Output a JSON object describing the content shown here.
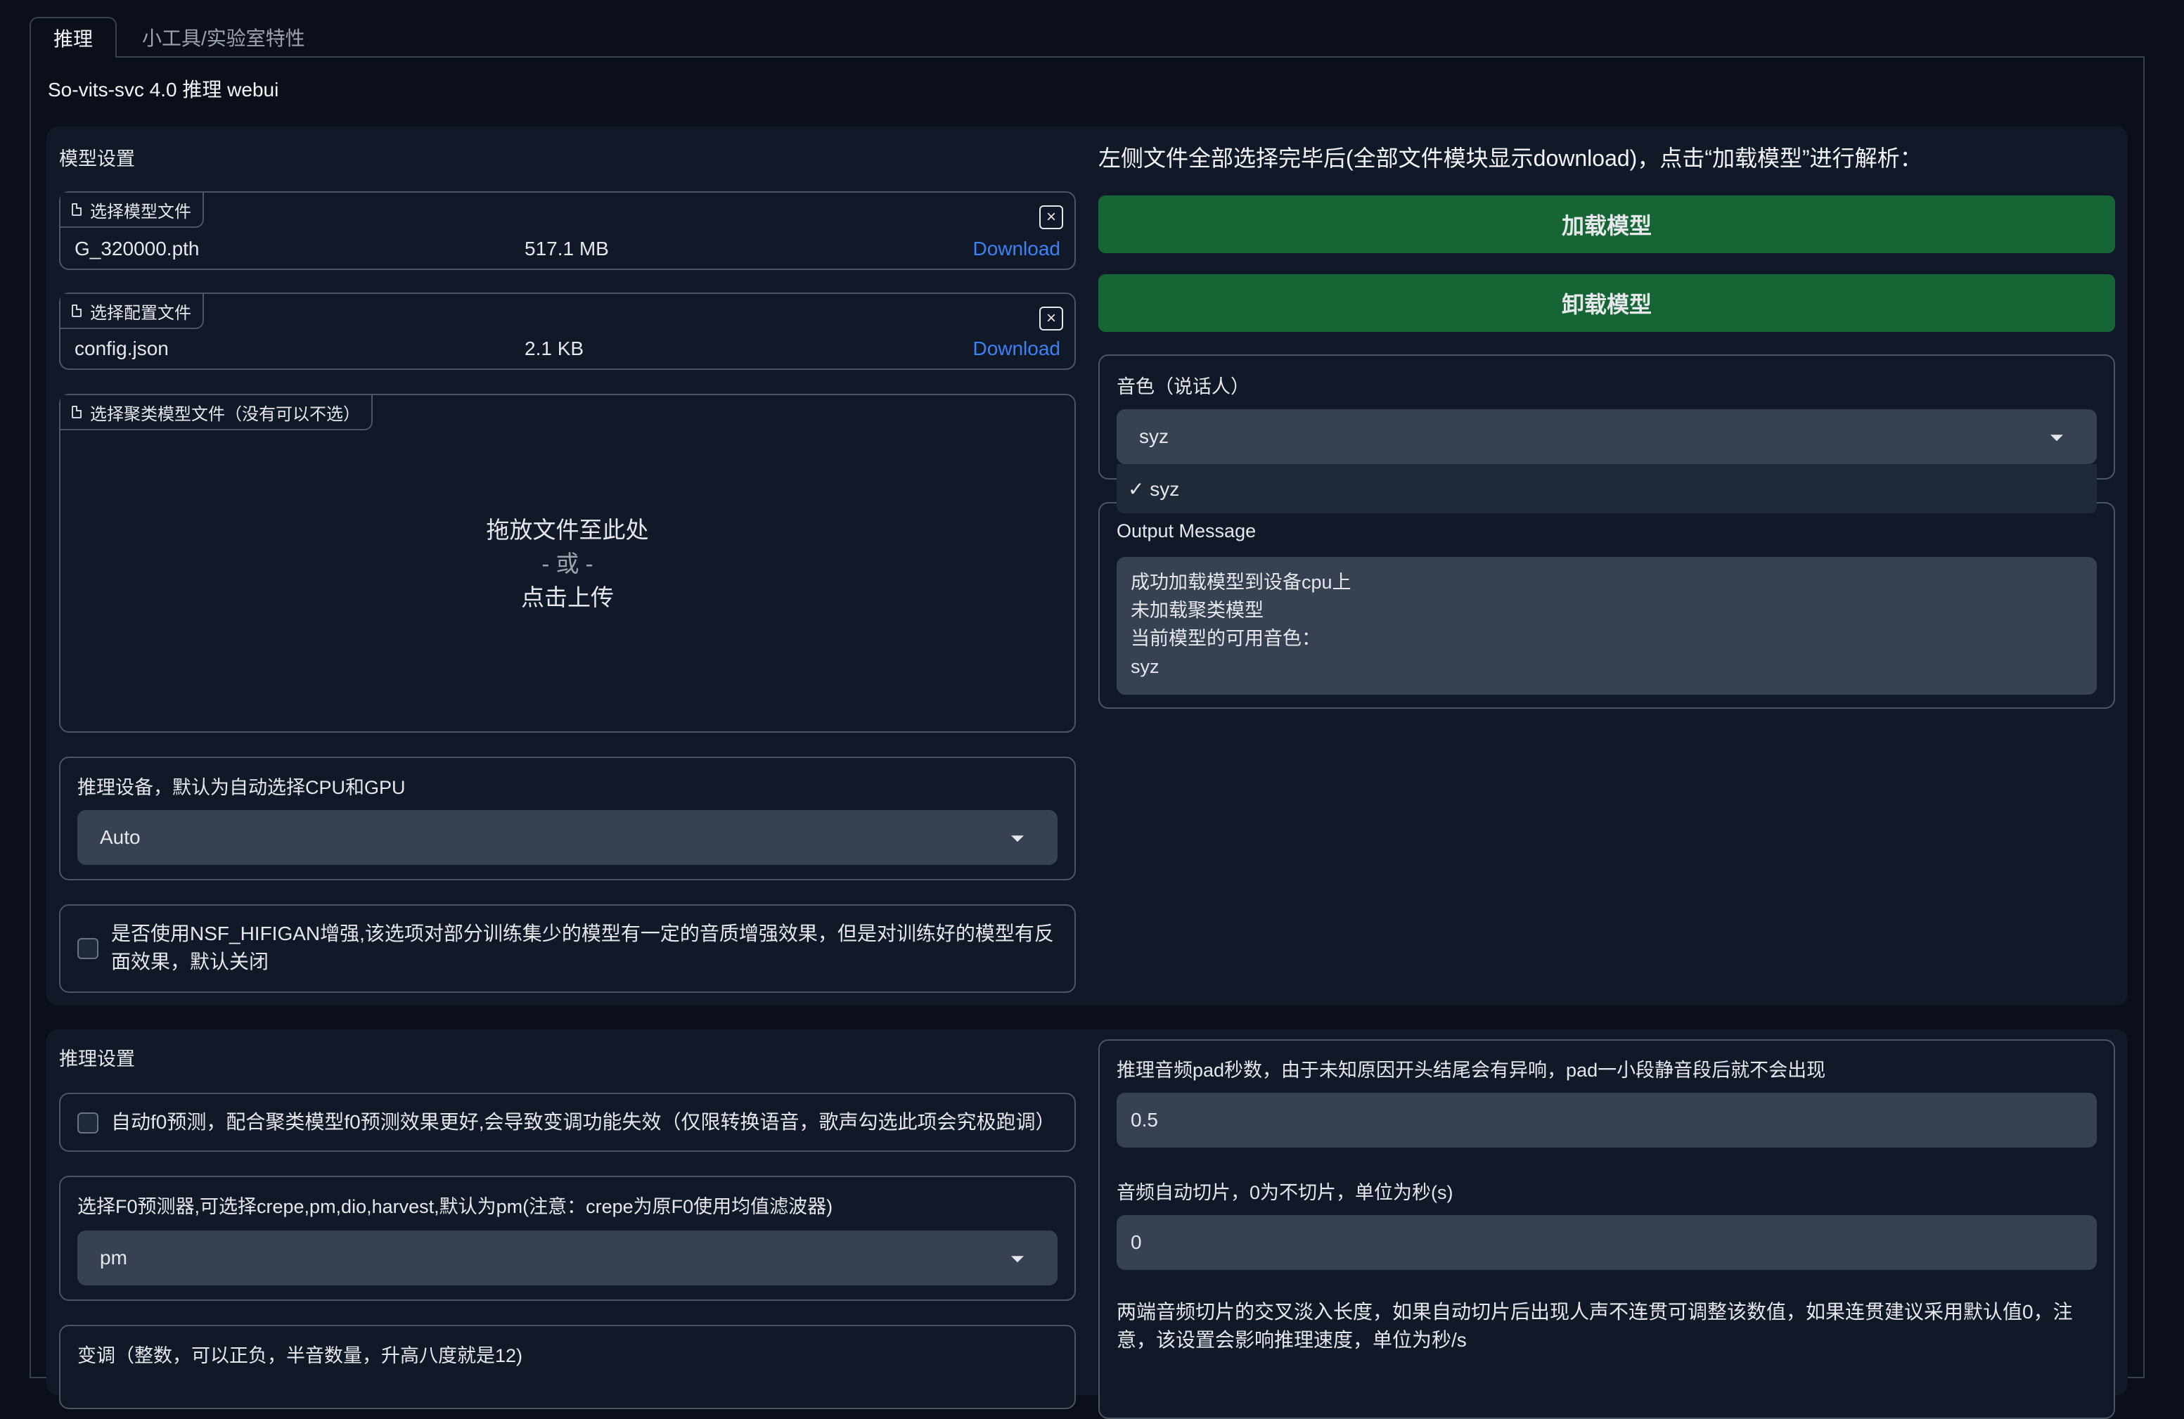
{
  "tabs": [
    {
      "label": "推理"
    },
    {
      "label": "小工具/实验室特性"
    }
  ],
  "page_title": "So-vits-svc 4.0 推理 webui",
  "model_settings": {
    "heading": "模型设置",
    "model_file": {
      "tag": "选择模型文件",
      "name": "G_320000.pth",
      "size": "517.1 MB",
      "download": "Download",
      "close": "×"
    },
    "config_file": {
      "tag": "选择配置文件",
      "name": "config.json",
      "size": "2.1 KB",
      "download": "Download",
      "close": "×"
    },
    "cluster_file": {
      "tag": "选择聚类模型文件（没有可以不选）",
      "drop_line1": "拖放文件至此处",
      "drop_line2": "- 或 -",
      "drop_line3": "点击上传"
    },
    "device": {
      "label": "推理设备，默认为自动选择CPU和GPU",
      "value": "Auto"
    },
    "nsf": {
      "label": "是否使用NSF_HIFIGAN增强,该选项对部分训练集少的模型有一定的音质增强效果，但是对训练好的模型有反面效果，默认关闭"
    }
  },
  "right_panel": {
    "instruction": "左侧文件全部选择完毕后(全部文件模块显示download)，点击“加载模型”进行解析：",
    "load_button": "加载模型",
    "unload_button": "卸载模型",
    "speaker": {
      "label": "音色（说话人）",
      "value": "syz",
      "option": "✓ syz"
    },
    "output": {
      "label": "Output Message",
      "text": "成功加载模型到设备cpu上\n未加载聚类模型\n当前模型的可用音色：\nsyz"
    }
  },
  "inference_settings": {
    "heading": "推理设置",
    "auto_f0": {
      "label": "自动f0预测，配合聚类模型f0预测效果更好,会导致变调功能失效（仅限转换语音，歌声勾选此项会究极跑调）"
    },
    "f0_predictor": {
      "label": "选择F0预测器,可选择crepe,pm,dio,harvest,默认为pm(注意：crepe为原F0使用均值滤波器)",
      "value": "pm"
    },
    "transpose": {
      "label": "变调（整数，可以正负，半音数量，升高八度就是12)"
    },
    "pad": {
      "label": "推理音频pad秒数，由于未知原因开头结尾会有异响，pad一小段静音段后就不会出现",
      "value": "0.5"
    },
    "slice": {
      "label": "音频自动切片，0为不切片，单位为秒(s)",
      "value": "0"
    },
    "crossfade": {
      "label": "两端音频切片的交叉淡入长度，如果自动切片后出现人声不连贯可调整该数值，如果连贯建议采用默认值0，注意，该设置会影响推理速度，单位为秒/s"
    }
  }
}
